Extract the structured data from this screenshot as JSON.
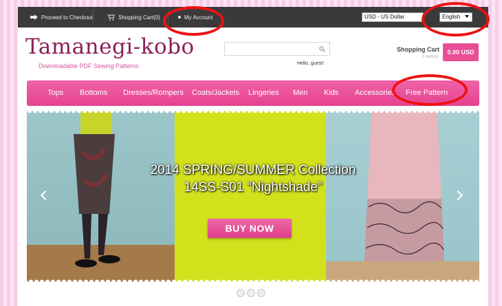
{
  "topbar": {
    "checkout": "Proceed to Checkout",
    "cart": "Shopping Cart(0)",
    "account": "My Account",
    "currency": "USD - US Dollar",
    "language": "English"
  },
  "header": {
    "logo": "Tamanegi-kobo",
    "tagline": "Downloadable PDF Sewing Patterns",
    "search_placeholder": "",
    "greeting": "Hello, guest!",
    "cart_title": "Shopping Cart",
    "cart_items": "0 item(s)",
    "cart_total": "0.00 USD"
  },
  "nav": {
    "items": [
      {
        "label": "Tops"
      },
      {
        "label": "Bottoms"
      },
      {
        "label": "Dresses/Rompers"
      },
      {
        "label": "Coats/Jackets"
      },
      {
        "label": "Lingeries"
      },
      {
        "label": "Men"
      },
      {
        "label": "Kids"
      },
      {
        "label": "Accessories"
      },
      {
        "label": "Free Pattern"
      }
    ]
  },
  "slider": {
    "headline_line1": "2014 SPRING/SUMMER Collection",
    "headline_line2": "14SS-S01 “Nightshade”",
    "cta": "BUY NOW",
    "slides": 3
  },
  "colors": {
    "brand_pink": "#e94d95",
    "logo_plum": "#8b1f5a",
    "annotation_red": "#ee1111"
  }
}
